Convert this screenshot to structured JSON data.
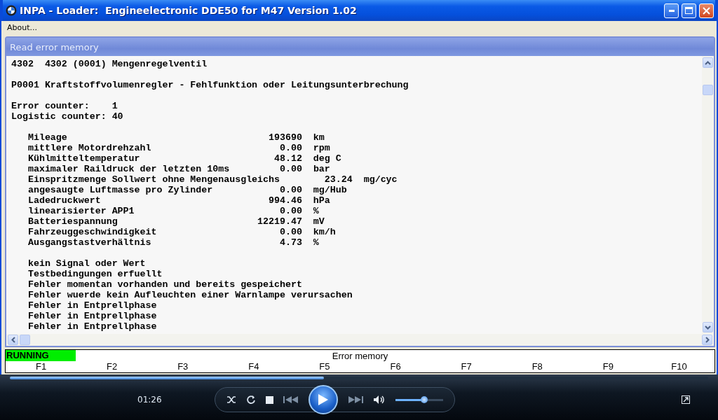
{
  "window": {
    "title": "INPA - Loader:  Engineelectronic DDE50 for M47 Version 1.02"
  },
  "menu": [
    "About..."
  ],
  "panel": {
    "title": "Read error memory",
    "lines": [
      {
        "kind": "text",
        "text": "4302  4302 (0001) Mengenregelventil"
      },
      {
        "kind": "blank"
      },
      {
        "kind": "text",
        "text": "P0001 Kraftstoffvolumenregler - Fehlfunktion oder Leitungsunterbrechung"
      },
      {
        "kind": "blank"
      },
      {
        "kind": "text",
        "text": "Error counter:    1"
      },
      {
        "kind": "text",
        "text": "Logistic counter: 40"
      },
      {
        "kind": "blank"
      },
      {
        "kind": "measurement",
        "label": "Mileage",
        "value": "193690",
        "unit": "km"
      },
      {
        "kind": "measurement",
        "label": "mittlere Motordrehzahl",
        "value": "0.00",
        "unit": "rpm"
      },
      {
        "kind": "measurement",
        "label": "Kühlmitteltemperatur",
        "value": "48.12",
        "unit": "deg C"
      },
      {
        "kind": "measurement",
        "label": "maximaler Raildruck der letzten 10ms",
        "value": "0.00",
        "unit": "bar"
      },
      {
        "kind": "measurement",
        "label": "Einspritzmenge Sollwert ohne Mengenausgleichs",
        "value": "23.24",
        "unit": "mg/cyc"
      },
      {
        "kind": "measurement",
        "label": "angesaugte Luftmasse pro Zylinder",
        "value": "0.00",
        "unit": "mg/Hub"
      },
      {
        "kind": "measurement",
        "label": "Ladedruckwert",
        "value": "994.46",
        "unit": "hPa"
      },
      {
        "kind": "measurement",
        "label": "linearisierter APP1",
        "value": "0.00",
        "unit": "%"
      },
      {
        "kind": "measurement",
        "label": "Batteriespannung",
        "value": "12219.47",
        "unit": "mV"
      },
      {
        "kind": "measurement",
        "label": "Fahrzeuggeschwindigkeit",
        "value": "0.00",
        "unit": "km/h"
      },
      {
        "kind": "measurement",
        "label": "Ausgangstastverhältnis",
        "value": "4.73",
        "unit": "%"
      },
      {
        "kind": "blank"
      },
      {
        "kind": "indented",
        "text": "kein Signal oder Wert"
      },
      {
        "kind": "indented",
        "text": "Testbedingungen erfuellt"
      },
      {
        "kind": "indented",
        "text": "Fehler momentan vorhanden und bereits gespeichert"
      },
      {
        "kind": "indented",
        "text": "Fehler wuerde kein Aufleuchten einer Warnlampe verursachen"
      },
      {
        "kind": "indented",
        "text": "Fehler in Entprellphase"
      },
      {
        "kind": "indented",
        "text": "Fehler in Entprellphase"
      },
      {
        "kind": "indented",
        "text": "Fehler in Entprellphase"
      }
    ]
  },
  "status": {
    "state": "RUNNING",
    "color": "#00ee00",
    "caption": "Error memory"
  },
  "function_keys": [
    "F1",
    "F2",
    "F3",
    "F4",
    "F5",
    "F6",
    "F7",
    "F8",
    "F9",
    "F10"
  ],
  "player": {
    "seek": {
      "level": 0.45
    },
    "time": "01:26",
    "volume": {
      "level": 0.6
    }
  }
}
